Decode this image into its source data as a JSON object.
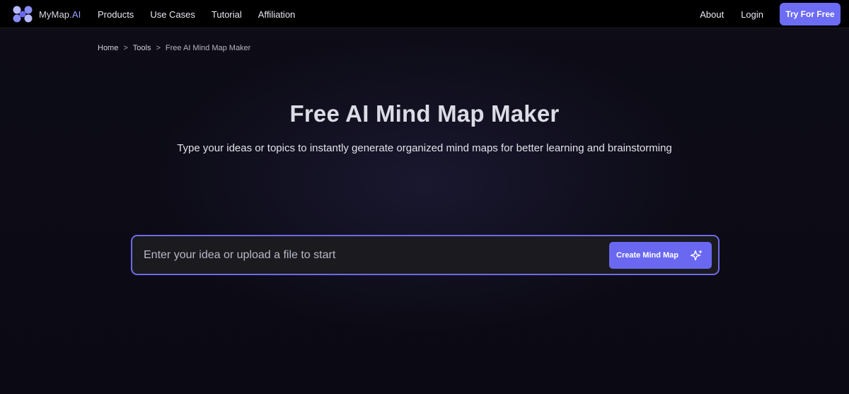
{
  "brand": {
    "name_main": "MyMap",
    "name_suffix": ".AI"
  },
  "nav": {
    "left": [
      {
        "label": "Products"
      },
      {
        "label": "Use Cases"
      },
      {
        "label": "Tutorial"
      },
      {
        "label": "Affiliation"
      }
    ],
    "about": "About",
    "login": "Login",
    "cta": "Try For Free"
  },
  "breadcrumb": {
    "items": [
      "Home",
      "Tools",
      "Free AI Mind Map Maker"
    ],
    "separator": ">"
  },
  "hero": {
    "title": "Free AI Mind Map Maker",
    "subtitle": "Type your ideas or topics to instantly generate organized mind maps for better learning and brainstorming"
  },
  "prompt": {
    "placeholder": "Enter your idea or upload a file to start",
    "value": "",
    "button_label": "Create Mind Map",
    "button_icon": "sparkle-icon"
  },
  "colors": {
    "accent": "#6c6cf5",
    "border_accent": "#6e6ae8",
    "background": "#0b0a14",
    "header_bg": "#000000"
  }
}
